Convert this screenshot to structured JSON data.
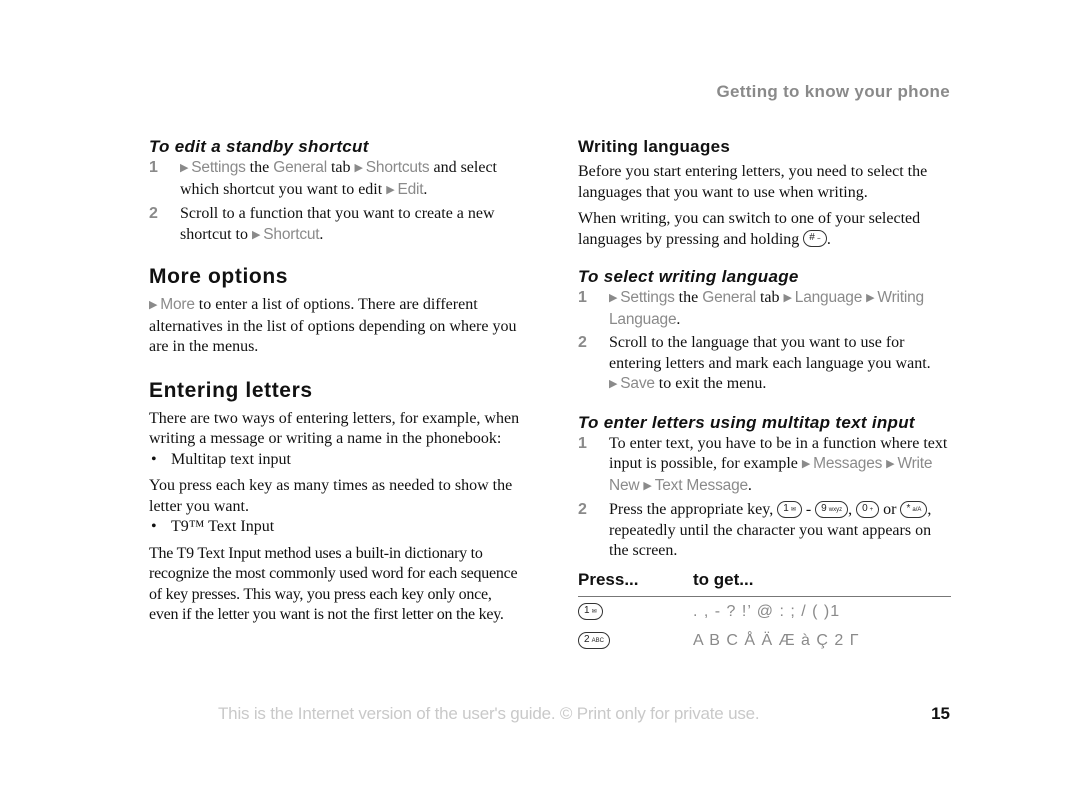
{
  "running_head": "Getting to know your phone",
  "left": {
    "edit_shortcut": {
      "title": "To edit a standby shortcut",
      "steps": [
        {
          "num": "1",
          "parts": [
            {
              "type": "menu",
              "text": "Settings"
            },
            {
              "type": "text",
              "text": " the "
            },
            {
              "type": "menu",
              "text": "General",
              "no_arrow": true
            },
            {
              "type": "text",
              "text": " tab "
            },
            {
              "type": "menu",
              "text": "Shortcuts"
            },
            {
              "type": "text",
              "text": " and select which shortcut you want to edit "
            },
            {
              "type": "menu",
              "text": "Edit"
            },
            {
              "type": "text",
              "text": "."
            }
          ]
        },
        {
          "num": "2",
          "parts": [
            {
              "type": "text",
              "text": "Scroll to a function that you want to create a new shortcut to "
            },
            {
              "type": "menu",
              "text": "Shortcut"
            },
            {
              "type": "text",
              "text": "."
            }
          ]
        }
      ]
    },
    "more_options": {
      "title": "More options",
      "para": [
        {
          "type": "menu",
          "text": "More"
        },
        {
          "type": "text",
          "text": " to enter a list of options. There are different alternatives in the list of options depending on where you are in the menus."
        }
      ]
    },
    "entering_letters": {
      "title": "Entering letters",
      "intro": "There are two ways of entering letters, for example, when writing a message or writing a name in the phonebook:",
      "bullet1": "Multitap text input",
      "para1": "You press each key as many times as needed to show the letter you want.",
      "bullet2": "T9™ Text Input",
      "para2": "The T9 Text Input method uses a built-in dictionary to recognize the most commonly used word for each sequence of key presses. This way, you press each key only once, even if the letter you want is not the first letter on the key."
    }
  },
  "right": {
    "writing_languages": {
      "title": "Writing languages",
      "para1": "Before you start entering letters, you need to select the languages that you want to use when writing.",
      "para2_text": "When writing, you can switch to one of your selected languages by pressing and holding",
      "para2_key": {
        "main": "#",
        "sub": "⌣"
      },
      "para2_end": "."
    },
    "select_language": {
      "title": "To select writing language",
      "steps": [
        {
          "num": "1",
          "parts": [
            {
              "type": "menu",
              "text": "Settings"
            },
            {
              "type": "text",
              "text": " the "
            },
            {
              "type": "menu",
              "text": "General",
              "no_arrow": true
            },
            {
              "type": "text",
              "text": " tab "
            },
            {
              "type": "menu",
              "text": "Language"
            },
            {
              "type": "text",
              "text": " "
            },
            {
              "type": "menu",
              "text": "Writing Language"
            },
            {
              "type": "text",
              "text": "."
            }
          ]
        },
        {
          "num": "2",
          "parts": [
            {
              "type": "text",
              "text": "Scroll to the language that you want to use for entering letters and mark each language you want. "
            },
            {
              "type": "menu",
              "text": "Save"
            },
            {
              "type": "text",
              "text": " to exit the menu."
            }
          ]
        }
      ]
    },
    "multitap": {
      "title": "To enter letters using multitap text input",
      "steps": [
        {
          "num": "1",
          "parts": [
            {
              "type": "text",
              "text": "To enter text, you have to be in a function where text input is possible, for example "
            },
            {
              "type": "menu",
              "text": "Messages"
            },
            {
              "type": "text",
              "text": " "
            },
            {
              "type": "menu",
              "text": "Write New"
            },
            {
              "type": "text",
              "text": " "
            },
            {
              "type": "menu",
              "text": "Text Message"
            },
            {
              "type": "text",
              "text": "."
            }
          ]
        },
        {
          "num": "2",
          "parts": [
            {
              "type": "text",
              "text": "Press the appropriate key, "
            },
            {
              "type": "key",
              "main": "1",
              "sub": "✉"
            },
            {
              "type": "text",
              "text": " - "
            },
            {
              "type": "key",
              "main": "9",
              "sub": "wxyz"
            },
            {
              "type": "text",
              "text": ", "
            },
            {
              "type": "key",
              "main": "0",
              "sub": "+"
            },
            {
              "type": "text",
              "text": " or "
            },
            {
              "type": "key",
              "main": "*",
              "sub": "a/A"
            },
            {
              "type": "text",
              "text": ", repeatedly until the character you want appears on the screen."
            }
          ]
        }
      ]
    },
    "press_table": {
      "headers": [
        "Press...",
        "to get..."
      ],
      "rows": [
        {
          "key": {
            "main": "1",
            "sub": "✉"
          },
          "chars": ". , - ? !’ @ : ; / ( )1"
        },
        {
          "key": {
            "main": "2",
            "sub": "ABC"
          },
          "chars": "A B C Å Ä Æ à Ç 2 Γ"
        }
      ]
    }
  },
  "footer": {
    "notice": "This is the Internet version of the user's guide. © Print only for private use.",
    "page_number": "15"
  }
}
